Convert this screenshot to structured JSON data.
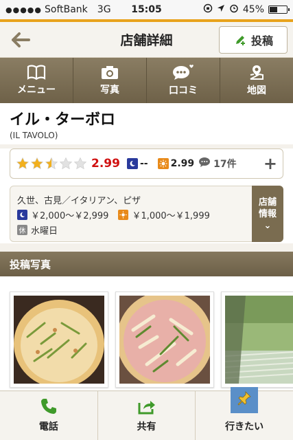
{
  "status_bar": {
    "signal": "●●●●●",
    "carrier": "SoftBank",
    "network": "3G",
    "time": "15:05",
    "battery": "45%",
    "battery_level": 0.45
  },
  "header": {
    "title": "店舗詳細",
    "post_label": "投稿"
  },
  "tabs": [
    {
      "label": "メニュー",
      "icon": "book-icon"
    },
    {
      "label": "写真",
      "icon": "camera-icon"
    },
    {
      "label": "口コミ",
      "icon": "speech-bubble-icon"
    },
    {
      "label": "地図",
      "icon": "map-pin-icon"
    }
  ],
  "shop": {
    "name": "イル・ターボロ",
    "name_en": "(IL TAVOLO)"
  },
  "rating": {
    "stars": 2.5,
    "score": "2.99",
    "dinner_score": "--",
    "lunch_score": "2.99",
    "review_count": "17件"
  },
  "info": {
    "area_genre": "久世、古見／イタリアン、ピザ",
    "dinner_budget": "￥2,000～￥2,999",
    "lunch_budget": "￥1,000～￥1,999",
    "closed_label": "休",
    "closed_days": "水曜日",
    "store_info_line1": "店舗",
    "store_info_line2": "情報",
    "store_info_arrow": "⌄"
  },
  "photos_section": {
    "title": "投稿写真"
  },
  "bottom_bar": [
    {
      "label": "電話",
      "icon": "phone-icon"
    },
    {
      "label": "共有",
      "icon": "share-icon"
    },
    {
      "label": "行きたい",
      "icon": "pushpin-icon"
    }
  ],
  "colors": {
    "accent_orange": "#e8a21c",
    "tab_brown": "#7a6c50",
    "score_red": "#d01010",
    "green": "#3f9a2a"
  }
}
